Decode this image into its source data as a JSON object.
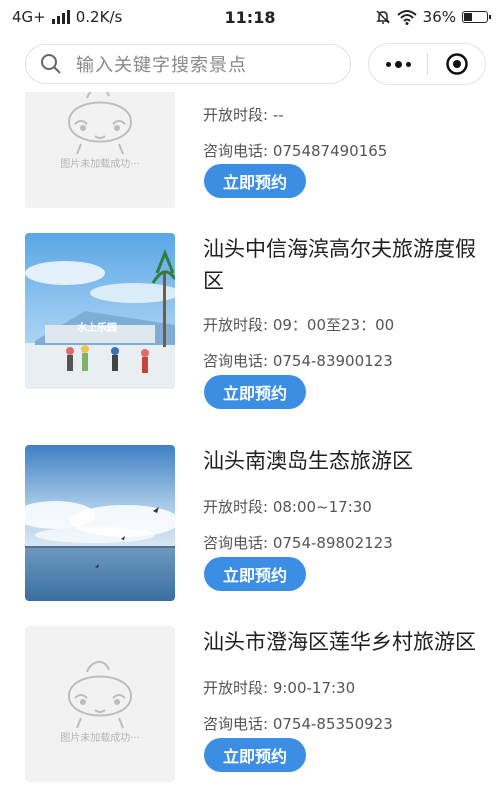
{
  "status_bar": {
    "network": "4G+",
    "speed": "0.2K/s",
    "time": "11:18",
    "battery": "36%",
    "battery_level": 0.36
  },
  "search": {
    "placeholder": "输入关键字搜索景点"
  },
  "colors": {
    "button": "#3c8ee5",
    "placeholder_bg": "#f2f2f2"
  },
  "items": [
    {
      "title": "",
      "hours": "开放时段: --",
      "phone": "咨询电话: 075487490165",
      "button": "立即预约",
      "image": "placeholder",
      "image_text": "图片未加载成功···"
    },
    {
      "title": "汕头中信海滨高尔夫旅游度假区",
      "hours": "开放时段: 09：00至23：00",
      "phone": "咨询电话: 0754-83900123",
      "button": "立即预约",
      "image": "water-park-photo",
      "image_text": "水上乐园"
    },
    {
      "title": "汕头南澳岛生态旅游区",
      "hours": "开放时段: 08:00~17:30",
      "phone": "咨询电话: 0754-89802123",
      "button": "立即预约",
      "image": "sea-bridge-photo"
    },
    {
      "title": "汕头市澄海区莲华乡村旅游区",
      "hours": "开放时段: 9:00-17:30",
      "phone": "咨询电话: 0754-85350923",
      "button": "立即预约",
      "image": "placeholder",
      "image_text": "图片未加载成功···"
    }
  ]
}
